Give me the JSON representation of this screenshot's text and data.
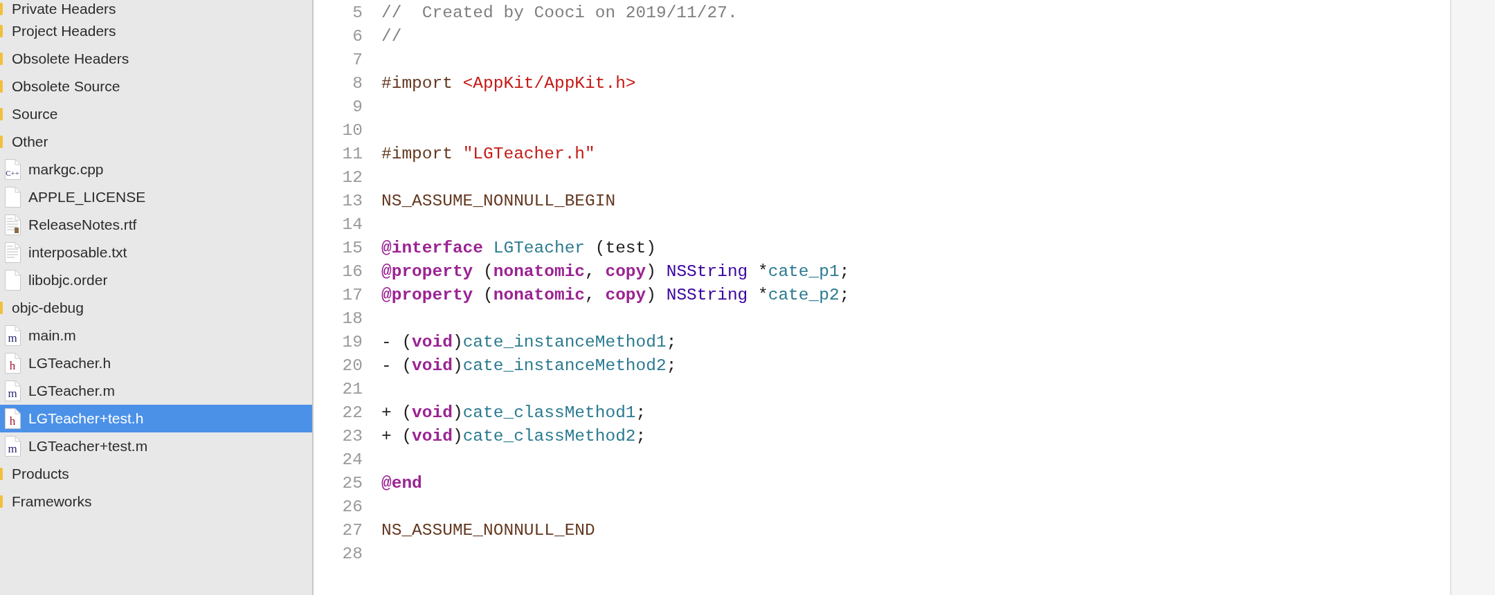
{
  "navigator": {
    "items": [
      {
        "label": "Private Headers",
        "kind": "folder",
        "selected": false
      },
      {
        "label": "Project Headers",
        "kind": "folder",
        "selected": false
      },
      {
        "label": "Obsolete Headers",
        "kind": "folder",
        "selected": false
      },
      {
        "label": "Obsolete Source",
        "kind": "folder",
        "selected": false
      },
      {
        "label": "Source",
        "kind": "folder",
        "selected": false
      },
      {
        "label": "Other",
        "kind": "folder",
        "selected": false,
        "children": [
          {
            "label": "markgc.cpp",
            "kind": "source",
            "icon_text": "C++",
            "selected": false
          },
          {
            "label": "APPLE_LICENSE",
            "kind": "plain",
            "selected": false
          },
          {
            "label": "ReleaseNotes.rtf",
            "kind": "rtf",
            "selected": false
          },
          {
            "label": "interposable.txt",
            "kind": "text",
            "selected": false
          },
          {
            "label": "libobjc.order",
            "kind": "plain",
            "selected": false
          }
        ]
      },
      {
        "label": "objc-debug",
        "kind": "folder",
        "selected": false,
        "children": [
          {
            "label": "main.m",
            "kind": "source",
            "icon_text": "m",
            "selected": false
          },
          {
            "label": "LGTeacher.h",
            "kind": "header",
            "icon_text": "h",
            "selected": false
          },
          {
            "label": "LGTeacher.m",
            "kind": "source",
            "icon_text": "m",
            "selected": false
          },
          {
            "label": "LGTeacher+test.h",
            "kind": "header",
            "icon_text": "h",
            "selected": true
          },
          {
            "label": "LGTeacher+test.m",
            "kind": "source",
            "icon_text": "m",
            "selected": false
          }
        ]
      },
      {
        "label": "Products",
        "kind": "folder",
        "selected": false
      },
      {
        "label": "Frameworks",
        "kind": "folder",
        "selected": false
      }
    ]
  },
  "editor": {
    "lines": [
      {
        "number": "5",
        "tokens": [
          {
            "text": "//  Created by Cooci on 2019/11/27.",
            "kind": "comment"
          }
        ]
      },
      {
        "number": "6",
        "tokens": [
          {
            "text": "//",
            "kind": "comment"
          }
        ]
      },
      {
        "number": "7"
      },
      {
        "number": "8",
        "tokens": [
          {
            "text": "#import ",
            "kind": "preprocessor"
          },
          {
            "text": "<AppKit/AppKit.h>",
            "kind": "string"
          }
        ]
      },
      {
        "number": "9"
      },
      {
        "number": "10"
      },
      {
        "number": "11",
        "tokens": [
          {
            "text": "#import ",
            "kind": "preprocessor"
          },
          {
            "text": "\"LGTeacher.h\"",
            "kind": "string"
          }
        ]
      },
      {
        "number": "12"
      },
      {
        "number": "13",
        "tokens": [
          {
            "text": "NS_ASSUME_NONNULL_BEGIN",
            "kind": "preprocessor"
          }
        ]
      },
      {
        "number": "14"
      },
      {
        "number": "15",
        "tokens": [
          {
            "text": "@interface",
            "kind": "keyword"
          },
          {
            "text": " LGTeacher",
            "kind": "project"
          },
          {
            "text": " (test)",
            "kind": "plain"
          }
        ]
      },
      {
        "number": "16",
        "tokens": [
          {
            "text": "@property",
            "kind": "keyword"
          },
          {
            "text": " (",
            "kind": "plain"
          },
          {
            "text": "nonatomic",
            "kind": "keyword"
          },
          {
            "text": ", ",
            "kind": "plain"
          },
          {
            "text": "copy",
            "kind": "keyword"
          },
          {
            "text": ") ",
            "kind": "plain"
          },
          {
            "text": "NSString",
            "kind": "type"
          },
          {
            "text": " *",
            "kind": "plain"
          },
          {
            "text": "cate_p1",
            "kind": "project"
          },
          {
            "text": ";",
            "kind": "plain"
          }
        ]
      },
      {
        "number": "17",
        "tokens": [
          {
            "text": "@property",
            "kind": "keyword"
          },
          {
            "text": " (",
            "kind": "plain"
          },
          {
            "text": "nonatomic",
            "kind": "keyword"
          },
          {
            "text": ", ",
            "kind": "plain"
          },
          {
            "text": "copy",
            "kind": "keyword"
          },
          {
            "text": ") ",
            "kind": "plain"
          },
          {
            "text": "NSString",
            "kind": "type"
          },
          {
            "text": " *",
            "kind": "plain"
          },
          {
            "text": "cate_p2",
            "kind": "project"
          },
          {
            "text": ";",
            "kind": "plain"
          }
        ]
      },
      {
        "number": "18"
      },
      {
        "number": "19",
        "tokens": [
          {
            "text": "- (",
            "kind": "plain"
          },
          {
            "text": "void",
            "kind": "keyword"
          },
          {
            "text": ")",
            "kind": "plain"
          },
          {
            "text": "cate_instanceMethod1",
            "kind": "project"
          },
          {
            "text": ";",
            "kind": "plain"
          }
        ]
      },
      {
        "number": "20",
        "tokens": [
          {
            "text": "- (",
            "kind": "plain"
          },
          {
            "text": "void",
            "kind": "keyword"
          },
          {
            "text": ")",
            "kind": "plain"
          },
          {
            "text": "cate_instanceMethod2",
            "kind": "project"
          },
          {
            "text": ";",
            "kind": "plain"
          }
        ]
      },
      {
        "number": "21"
      },
      {
        "number": "22",
        "tokens": [
          {
            "text": "+ (",
            "kind": "plain"
          },
          {
            "text": "void",
            "kind": "keyword"
          },
          {
            "text": ")",
            "kind": "plain"
          },
          {
            "text": "cate_classMethod1",
            "kind": "project"
          },
          {
            "text": ";",
            "kind": "plain"
          }
        ]
      },
      {
        "number": "23",
        "tokens": [
          {
            "text": "+ (",
            "kind": "plain"
          },
          {
            "text": "void",
            "kind": "keyword"
          },
          {
            "text": ")",
            "kind": "plain"
          },
          {
            "text": "cate_classMethod2",
            "kind": "project"
          },
          {
            "text": ";",
            "kind": "plain"
          }
        ]
      },
      {
        "number": "24"
      },
      {
        "number": "25",
        "tokens": [
          {
            "text": "@end",
            "kind": "keyword"
          }
        ]
      },
      {
        "number": "26"
      },
      {
        "number": "27",
        "tokens": [
          {
            "text": "NS_ASSUME_NONNULL_END",
            "kind": "preprocessor"
          }
        ]
      },
      {
        "number": "28"
      }
    ]
  }
}
